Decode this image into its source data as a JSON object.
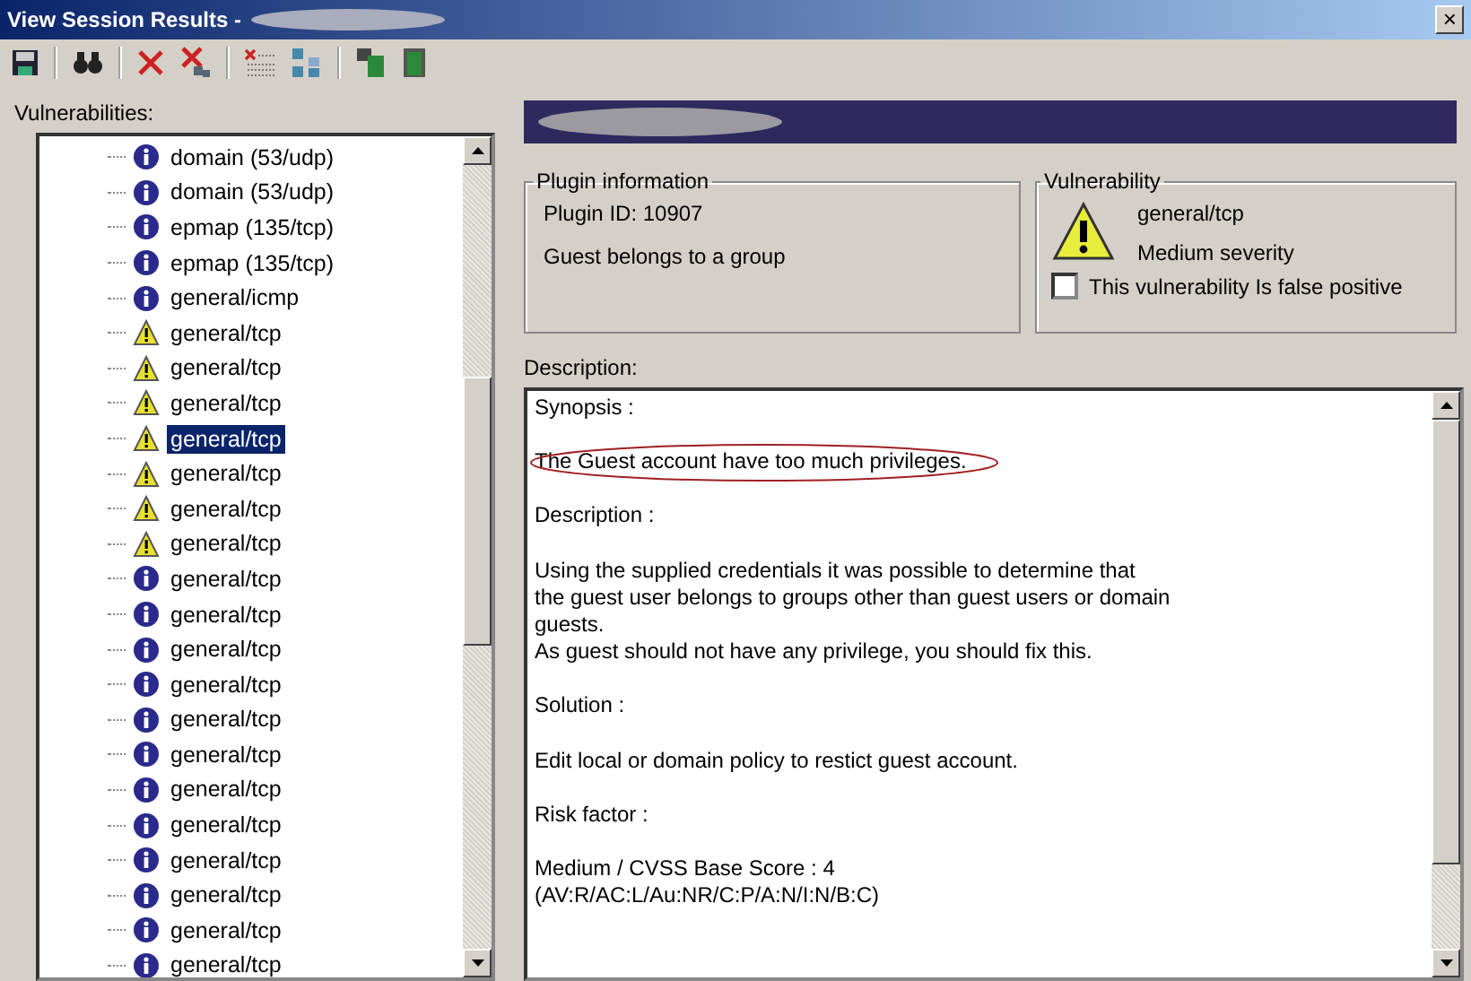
{
  "window": {
    "title": "View Session Results -",
    "close": "×"
  },
  "vulnerabilities": {
    "label": "Vulnerabilities:",
    "items": [
      {
        "label": "domain (53/udp)",
        "kind": "info",
        "selected": false
      },
      {
        "label": "domain (53/udp)",
        "kind": "info",
        "selected": false
      },
      {
        "label": "epmap (135/tcp)",
        "kind": "info",
        "selected": false
      },
      {
        "label": "epmap (135/tcp)",
        "kind": "info",
        "selected": false
      },
      {
        "label": "general/icmp",
        "kind": "info",
        "selected": false
      },
      {
        "label": "general/tcp",
        "kind": "warning",
        "selected": false
      },
      {
        "label": "general/tcp",
        "kind": "warning",
        "selected": false
      },
      {
        "label": "general/tcp",
        "kind": "warning",
        "selected": false
      },
      {
        "label": "general/tcp",
        "kind": "warning",
        "selected": true
      },
      {
        "label": "general/tcp",
        "kind": "warning",
        "selected": false
      },
      {
        "label": "general/tcp",
        "kind": "warning",
        "selected": false
      },
      {
        "label": "general/tcp",
        "kind": "warning",
        "selected": false
      },
      {
        "label": "general/tcp",
        "kind": "info",
        "selected": false
      },
      {
        "label": "general/tcp",
        "kind": "info",
        "selected": false
      },
      {
        "label": "general/tcp",
        "kind": "info",
        "selected": false
      },
      {
        "label": "general/tcp",
        "kind": "info",
        "selected": false
      },
      {
        "label": "general/tcp",
        "kind": "info",
        "selected": false
      },
      {
        "label": "general/tcp",
        "kind": "info",
        "selected": false
      },
      {
        "label": "general/tcp",
        "kind": "info",
        "selected": false
      },
      {
        "label": "general/tcp",
        "kind": "info",
        "selected": false
      },
      {
        "label": "general/tcp",
        "kind": "info",
        "selected": false
      },
      {
        "label": "general/tcp",
        "kind": "info",
        "selected": false
      },
      {
        "label": "general/tcp",
        "kind": "info",
        "selected": false
      },
      {
        "label": "general/tcp",
        "kind": "info",
        "selected": false
      }
    ]
  },
  "plugin_information": {
    "title": "Plugin information",
    "plugin_id": "Plugin ID: 10907",
    "name": "Guest belongs to a group"
  },
  "vulnerability": {
    "title": "Vulnerability",
    "port": "general/tcp",
    "severity": "Medium severity",
    "kind": "warning",
    "false_positive": {
      "label": "This vulnerability Is false positive",
      "checked": false
    }
  },
  "description": {
    "label": "Description:",
    "paragraphs": [
      {
        "lines": [
          "Synopsis :"
        ],
        "circled": false
      },
      {
        "lines": [
          "The Guest account have too much privileges."
        ],
        "circled": true
      },
      {
        "lines": [
          "Description :"
        ],
        "circled": false
      },
      {
        "lines": [
          "Using the supplied credentials it was possible to determine that",
          "the guest user belongs to groups other than guest users or domain",
          "guests.",
          "As guest should not have any privilege, you should fix this."
        ],
        "circled": false
      },
      {
        "lines": [
          "Solution :"
        ],
        "circled": false
      },
      {
        "lines": [
          "Edit local or domain policy to restict guest account."
        ],
        "circled": false
      },
      {
        "lines": [
          "Risk factor :"
        ],
        "circled": false
      },
      {
        "lines": [
          "Medium / CVSS Base Score : 4",
          "(AV:R/AC:L/Au:NR/C:P/A:N/I:N/B:C)"
        ],
        "circled": false
      }
    ]
  }
}
